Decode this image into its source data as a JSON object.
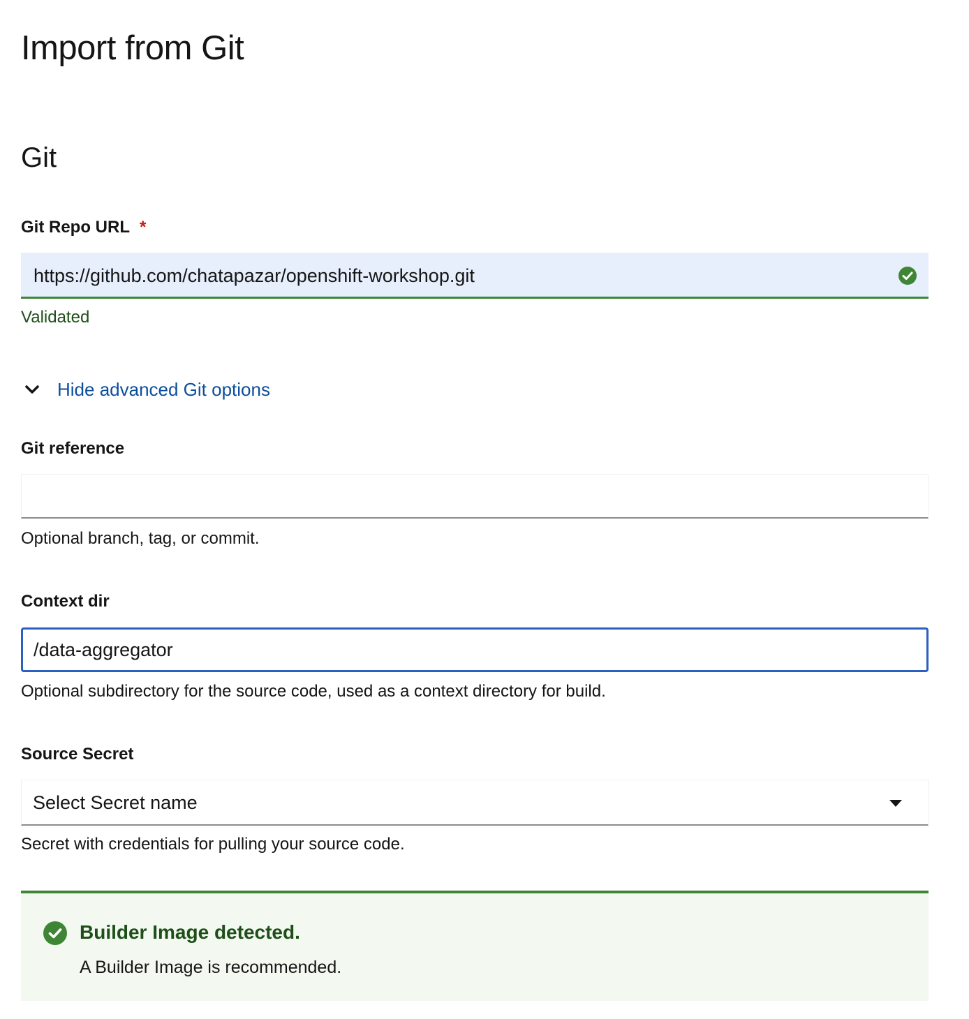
{
  "page": {
    "title": "Import from Git"
  },
  "git_section": {
    "title": "Git",
    "repo_url": {
      "label": "Git Repo URL",
      "required_marker": "*",
      "value": "https://github.com/chatapazar/openshift-workshop.git",
      "status_text": "Validated",
      "status_icon": "check-circle-icon",
      "status_color": "#3e8635"
    },
    "advanced_toggle": {
      "label": "Hide advanced Git options",
      "icon": "chevron-down-icon",
      "expanded": true
    },
    "git_reference": {
      "label": "Git reference",
      "value": "",
      "helper": "Optional branch, tag, or commit."
    },
    "context_dir": {
      "label": "Context dir",
      "value": "/data-aggregator",
      "helper": "Optional subdirectory for the source code, used as a context directory for build.",
      "focused": true
    },
    "source_secret": {
      "label": "Source Secret",
      "selected": "Select Secret name",
      "helper": "Secret with credentials for pulling your source code."
    }
  },
  "alert": {
    "variant": "success",
    "icon": "check-circle-icon",
    "title": "Builder Image detected.",
    "body": "A Builder Image is recommended."
  },
  "colors": {
    "success": "#3e8635",
    "link": "#0b4f9c",
    "focus": "#2b5fc0",
    "required": "#c9190b",
    "validated_bg": "#e7eefc",
    "alert_bg": "#f3f8f1"
  }
}
